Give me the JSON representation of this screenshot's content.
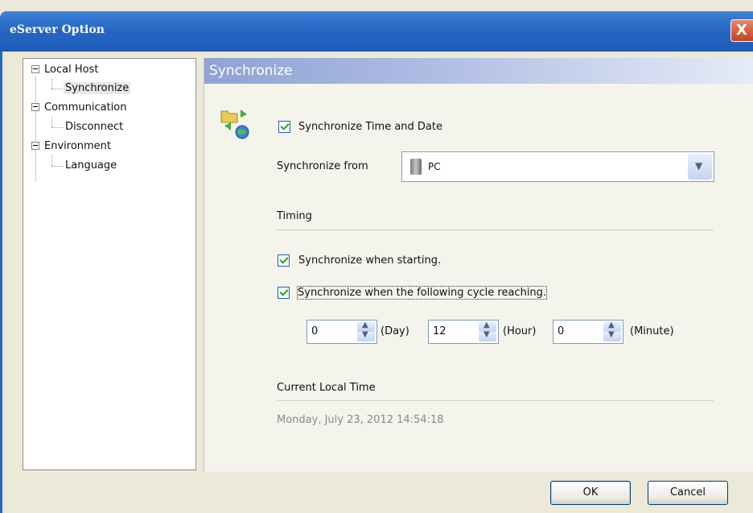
{
  "window": {
    "title": "eServer Option",
    "close_label": "X"
  },
  "tree": {
    "items": [
      {
        "label": "Local Host"
      },
      {
        "label": "Synchronize"
      },
      {
        "label": "Communication"
      },
      {
        "label": "Disconnect"
      },
      {
        "label": "Environment"
      },
      {
        "label": "Language"
      }
    ]
  },
  "panel": {
    "title": "Synchronize",
    "sync_time_date_label": "Synchronize Time and Date",
    "sync_from_label": "Synchronize from",
    "sync_from_value": "PC",
    "timing_heading": "Timing",
    "sync_starting_label": "Synchronize when starting.",
    "sync_cycle_label": "Synchronize when the following cycle reaching.",
    "cycle": {
      "day_value": "0",
      "day_label": "(Day)",
      "hour_value": "12",
      "hour_label": "(Hour)",
      "minute_value": "0",
      "minute_label": "(Minute)"
    },
    "current_time_heading": "Current Local Time",
    "current_time_value": "Monday, July 23, 2012 14:54:18"
  },
  "buttons": {
    "ok": "OK",
    "cancel": "Cancel"
  },
  "icons": {
    "sync": "sync-globe-icon",
    "device": "pc-icon",
    "dropdown": "chevron-down-icon"
  },
  "colors": {
    "titlebar": "#2667c4",
    "panel_header": "#8ea3d4",
    "checkmark": "#21a121"
  }
}
